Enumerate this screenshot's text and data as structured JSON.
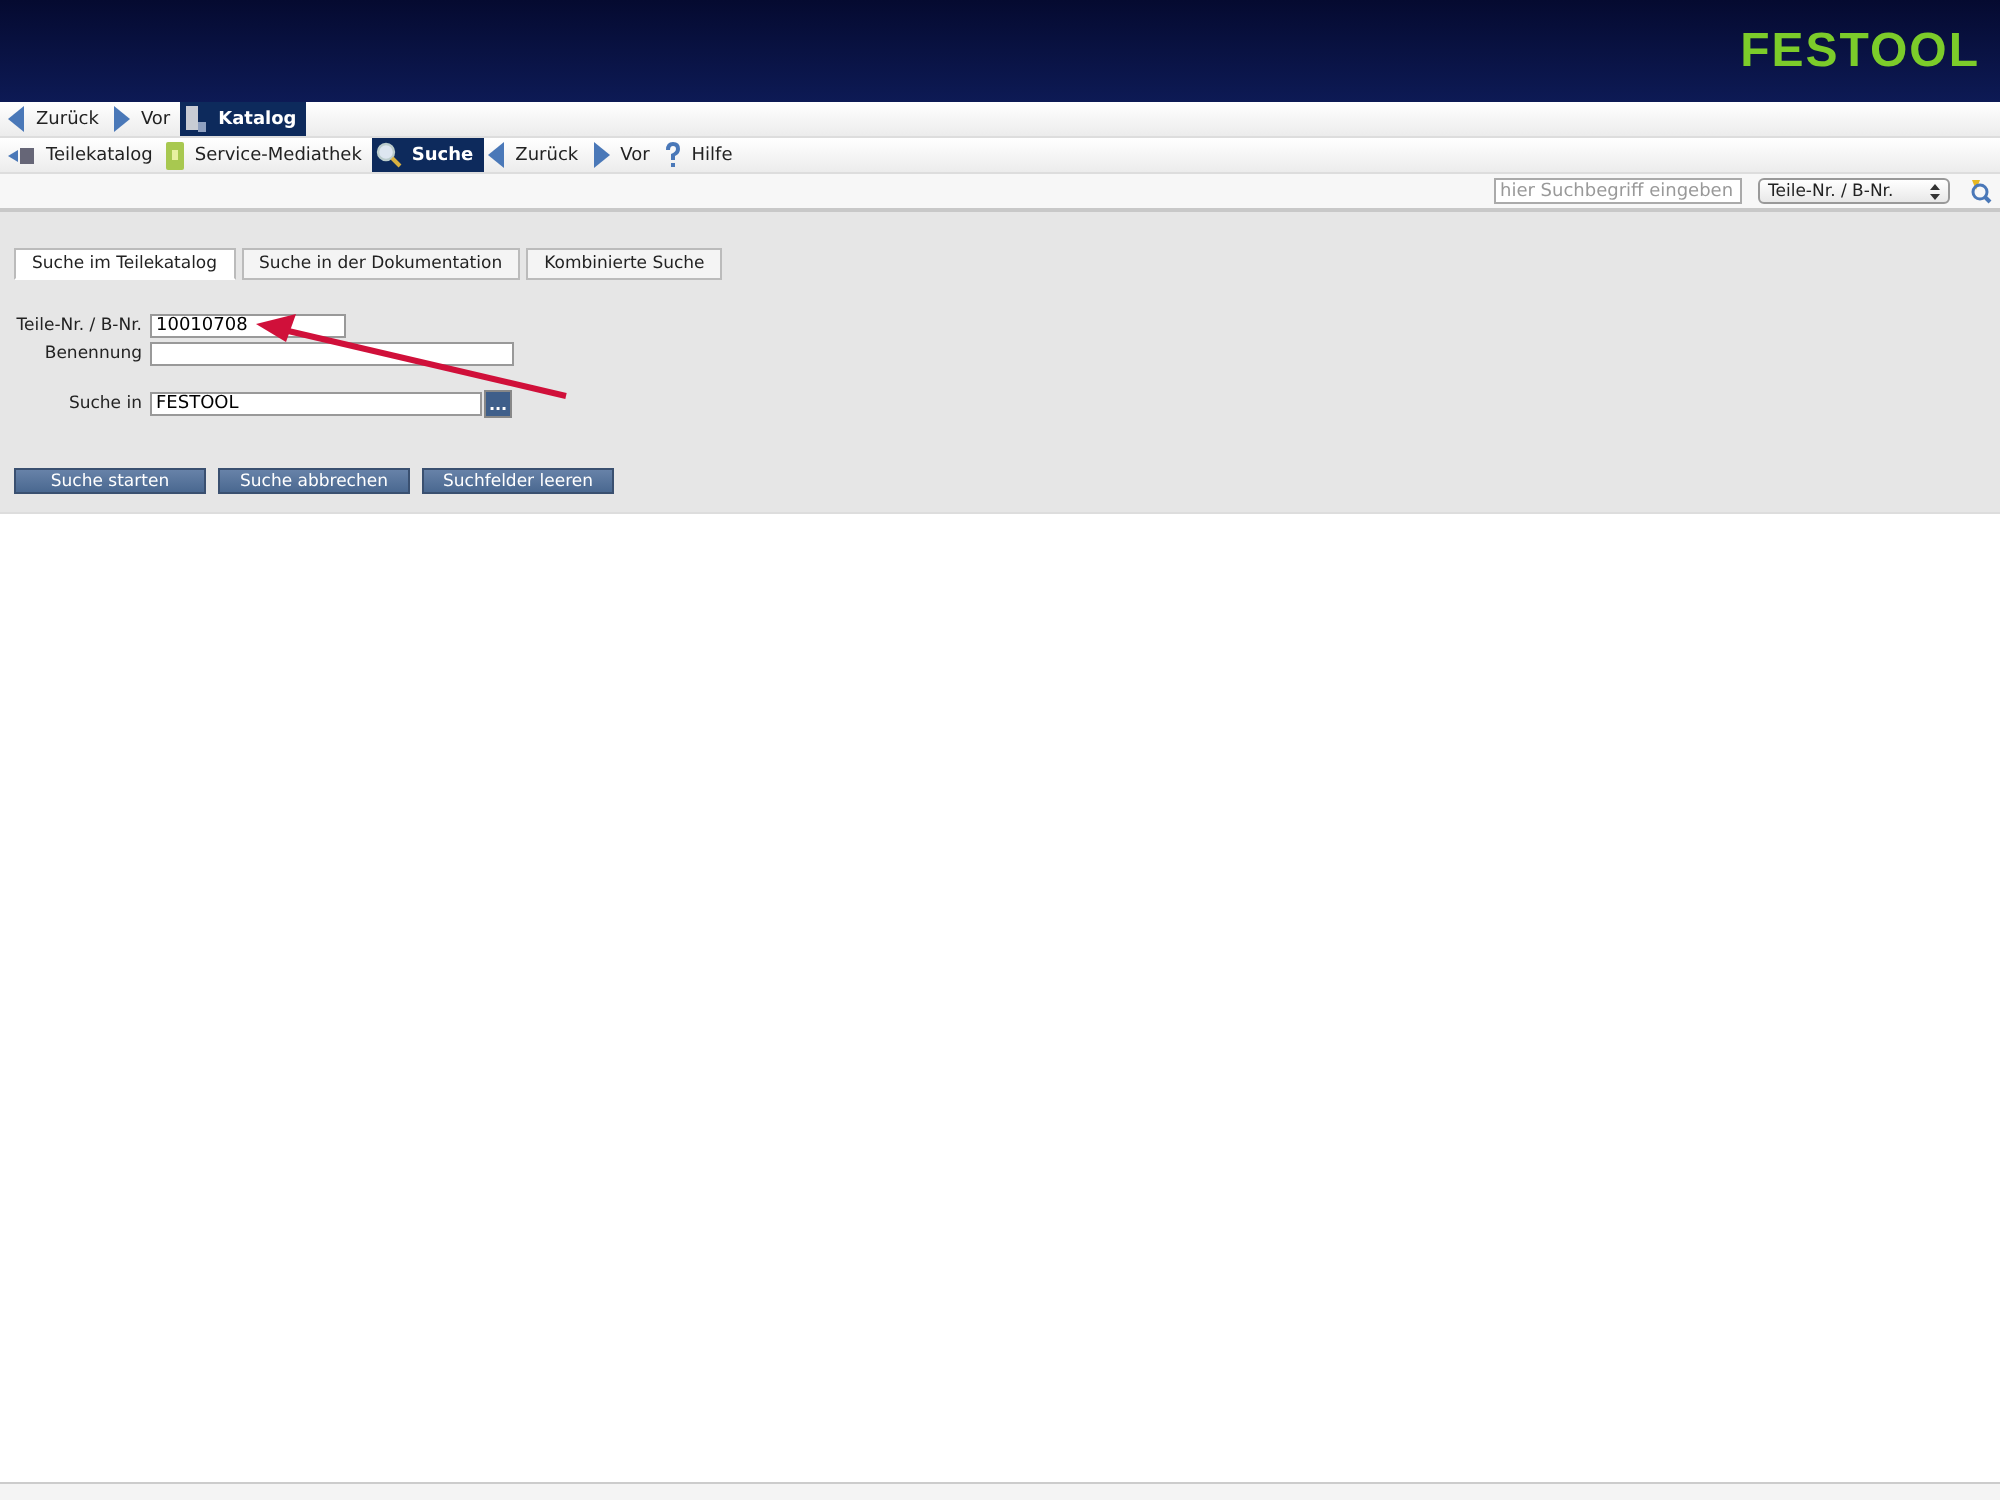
{
  "header": {
    "logo": "FESTOOL"
  },
  "nav_primary": [
    {
      "kind": "back",
      "label": "Zurück",
      "selected": false
    },
    {
      "kind": "forward",
      "label": "Vor",
      "selected": false
    },
    {
      "kind": "catalog",
      "label": "Katalog",
      "selected": true
    }
  ],
  "nav_secondary": [
    {
      "kind": "parts",
      "label": "Teilekatalog",
      "selected": false
    },
    {
      "kind": "media",
      "label": "Service-Mediathek",
      "selected": false
    },
    {
      "kind": "search",
      "label": "Suche",
      "selected": true
    },
    {
      "kind": "back",
      "label": "Zurück",
      "selected": false
    },
    {
      "kind": "forward",
      "label": "Vor",
      "selected": false
    },
    {
      "kind": "help",
      "label": "Hilfe",
      "selected": false
    }
  ],
  "toolbar": {
    "search": {
      "placeholder": "hier Suchbegriff eingeben"
    },
    "select": "Teile-Nr. / B-Nr."
  },
  "tabs": [
    {
      "label": "Suche im Teilekatalog",
      "selected": true
    },
    {
      "label": "Suche in der Dokumentation",
      "selected": false
    },
    {
      "label": "Kombinierte Suche",
      "selected": false
    }
  ],
  "fields": [
    {
      "label": "Teile-Nr. / B-Nr.",
      "value": "10010708",
      "kind": "short"
    },
    {
      "label": "Benennung",
      "kind": "long"
    },
    {
      "label": "Suche in",
      "value": "FESTOOL",
      "kind": "picker",
      "picker": "..."
    }
  ],
  "buttons": [
    "Suche starten",
    "Suche abbrechen",
    "Suchfelder leeren"
  ]
}
